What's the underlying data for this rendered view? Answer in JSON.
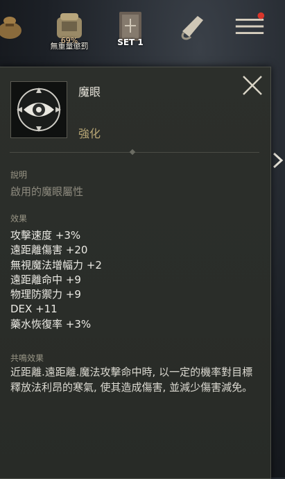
{
  "hud": {
    "bag_percent": "69%",
    "bag_label": "無重量懲罰",
    "set_label": "SET 1"
  },
  "item": {
    "name": "魔眼",
    "type": "強化"
  },
  "description": {
    "title": "說明",
    "text": "啟用的魔眼屬性"
  },
  "effects": {
    "title": "效果",
    "items": [
      "攻擊速度 +3%",
      "遠距離傷害 +20",
      "無視魔法增幅力 +2",
      "遠距離命中 +9",
      "物理防禦力 +9",
      "DEX +11",
      "藥水恢復率 +3%"
    ]
  },
  "resonance": {
    "title": "共鳴效果",
    "text": "近距離.遠距離.魔法攻擊命中時, 以一定的機率對目標釋放法利昂的寒氣, 使其造成傷害, 並減少傷害減免。"
  },
  "icons": {
    "close": "close-x-icon",
    "item": "eye-icon",
    "menu": "hamburger-menu-icon"
  },
  "colors": {
    "item_type": "#b7a574",
    "panel_bg": "#2c2f2b"
  }
}
